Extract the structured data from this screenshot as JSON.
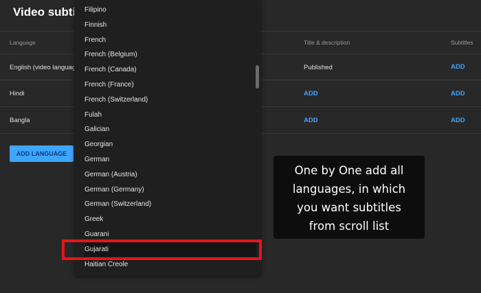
{
  "page": {
    "title": "Video subtit"
  },
  "table": {
    "headers": {
      "language": "Language",
      "title_desc": "Title & description",
      "subtitles": "Subtitles"
    },
    "rows": [
      {
        "language": "English (video language",
        "title_desc": "Published",
        "subtitles": "ADD"
      },
      {
        "language": "Hindi",
        "title_desc": "ADD",
        "subtitles": "ADD"
      },
      {
        "language": "Bangla",
        "title_desc": "ADD",
        "subtitles": "ADD"
      }
    ]
  },
  "add_language_label": "ADD LANGUAGE",
  "dropdown": {
    "items": [
      "Filipino",
      "Finnish",
      "French",
      "French (Belgium)",
      "French (Canada)",
      "French (France)",
      "French (Switzerland)",
      "Fulah",
      "Galician",
      "Georgian",
      "German",
      "German (Austria)",
      "German (Germany)",
      "German (Switzerland)",
      "Greek",
      "Guarani",
      "Gujarati",
      "Haitian Creole"
    ],
    "highlighted": "Gujarati"
  },
  "callout": {
    "lines": [
      "One by One add all",
      "languages, in which",
      "you want subtitles",
      "from scroll list"
    ]
  }
}
